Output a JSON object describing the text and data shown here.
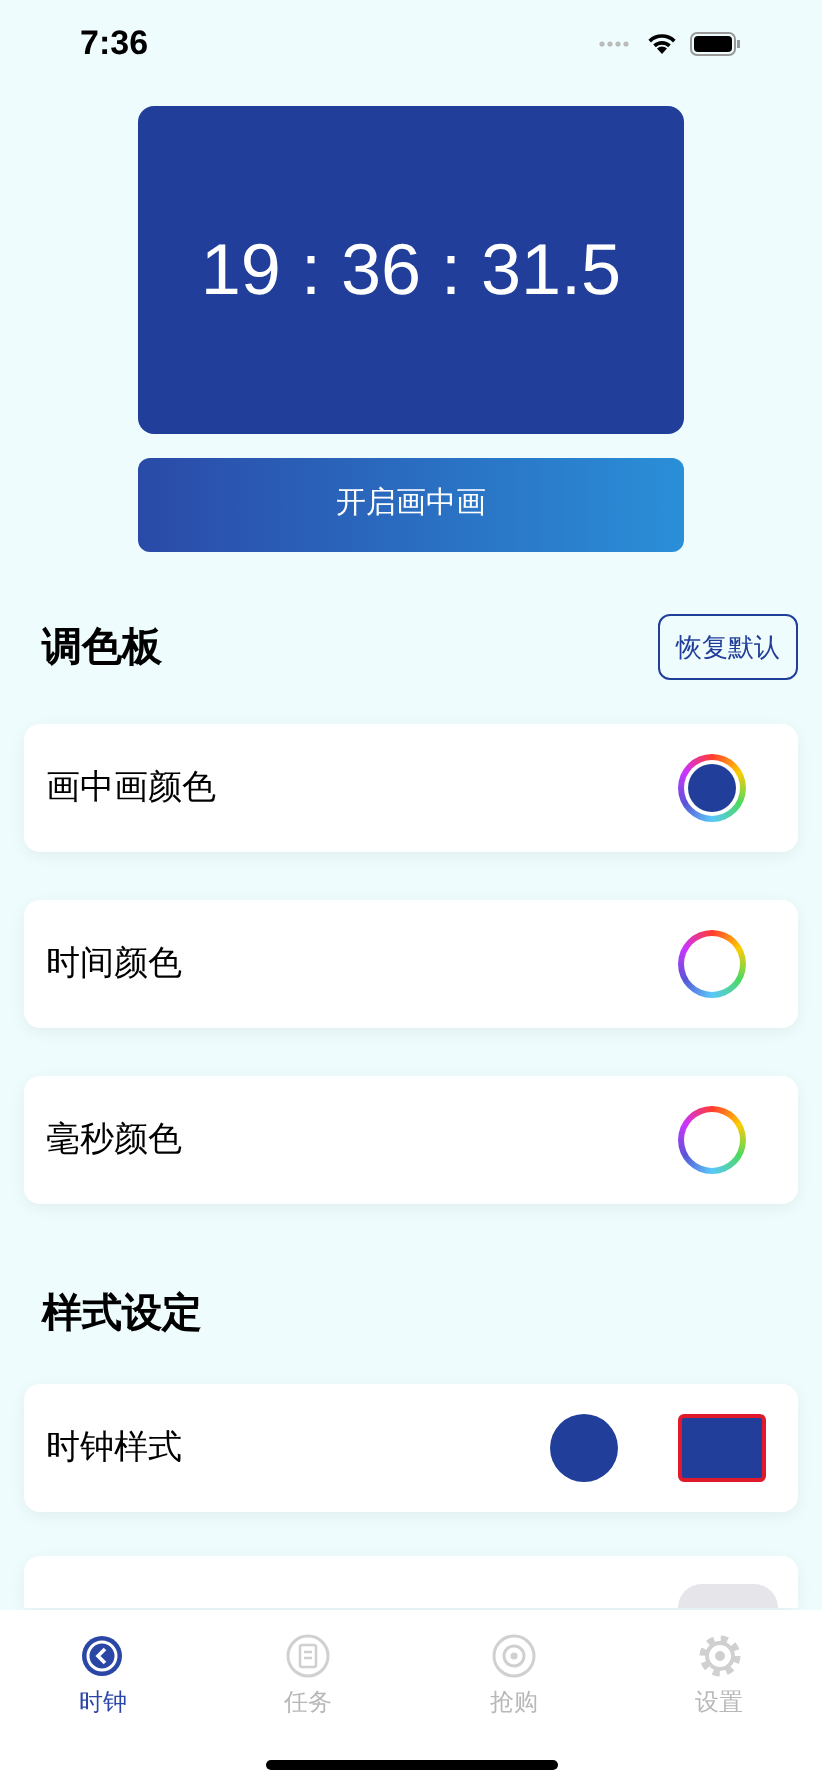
{
  "status_bar": {
    "time": "7:36"
  },
  "clock": {
    "time": "19 : 36 : 31.5"
  },
  "pip_button": {
    "label": "开启画中画"
  },
  "palette": {
    "title": "调色板",
    "reset_button": "恢复默认",
    "items": [
      {
        "label": "画中画颜色",
        "color": "#213f9a"
      },
      {
        "label": "时间颜色"
      },
      {
        "label": "毫秒颜色"
      }
    ]
  },
  "style": {
    "title": "样式设定",
    "rows": [
      {
        "label": "时钟样式",
        "options": [
          {
            "kind": "circle",
            "selected": false
          },
          {
            "kind": "square",
            "selected": true
          }
        ]
      }
    ],
    "partial_row": {
      "on": false
    }
  },
  "tab_bar": [
    {
      "label": "时钟",
      "selected": true
    },
    {
      "label": "任务",
      "selected": false
    },
    {
      "label": "抢购",
      "selected": false
    },
    {
      "label": "设置",
      "selected": false
    }
  ]
}
